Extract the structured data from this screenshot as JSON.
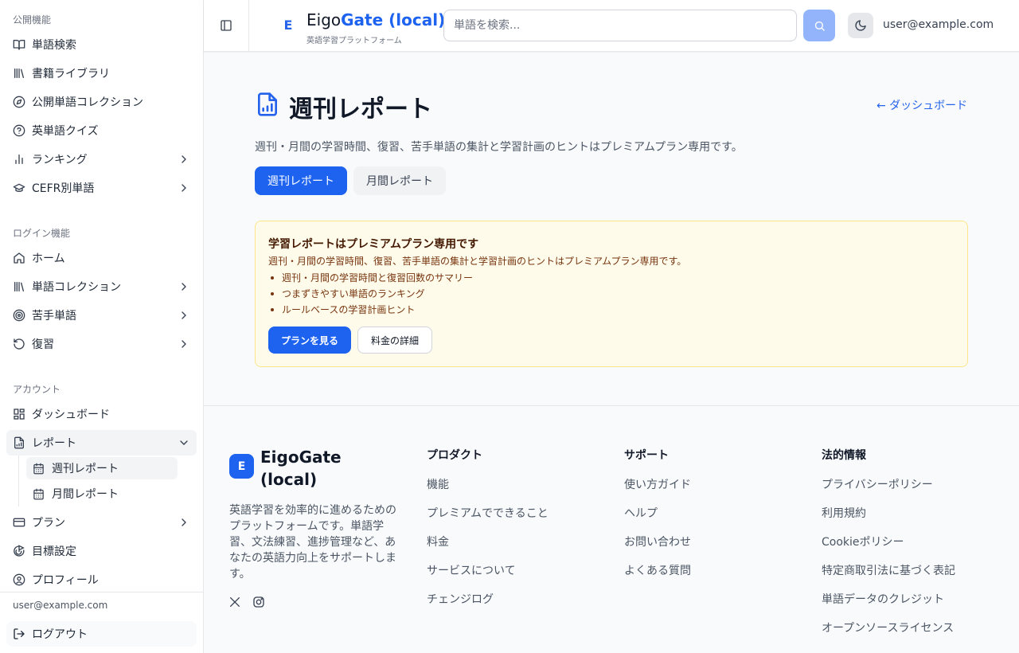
{
  "sidebar": {
    "sections": {
      "public": "公開機能",
      "login": "ログイン機能",
      "account": "アカウント"
    },
    "items": {
      "word_search": "単語検索",
      "book_library": "書籍ライブラリ",
      "public_collections": "公開単語コレクション",
      "quiz": "英単語クイズ",
      "ranking": "ランキング",
      "cefr": "CEFR別単語",
      "home": "ホーム",
      "word_collections": "単語コレクション",
      "weak_words": "苦手単語",
      "review": "復習",
      "dashboard": "ダッシュボード",
      "reports": "レポート",
      "weekly_report": "週刊レポート",
      "monthly_report": "月間レポート",
      "plan": "プラン",
      "goals": "目標設定",
      "profile": "プロフィール"
    },
    "user_email": "user@example.com",
    "logout": "ログアウト"
  },
  "header": {
    "logo_letter": "E",
    "brand_main": "Eigo",
    "brand_accent": "Gate (local)",
    "tagline": "英語学習プラットフォーム",
    "search_placeholder": "単語を検索...",
    "user_email": "user@example.com"
  },
  "main": {
    "title": "週刊レポート",
    "back_link": "← ダッシュボード",
    "description": "週刊・月間の学習時間、復習、苦手単語の集計と学習計画のヒントはプレミアムプラン専用です。",
    "tabs": {
      "weekly": "週刊レポート",
      "monthly": "月間レポート"
    },
    "promo": {
      "title": "学習レポートはプレミアムプラン専用です",
      "description": "週刊・月間の学習時間、復習、苦手単語の集計と学習計画のヒントはプレミアムプラン専用です。",
      "features": [
        "週刊・月間の学習時間と復習回数のサマリー",
        "つまずきやすい単語のランキング",
        "ルールベースの学習計画ヒント"
      ],
      "primary_button": "プランを見る",
      "secondary_button": "料金の詳細"
    }
  },
  "footer": {
    "logo_letter": "E",
    "brand": "EigoGate (local)",
    "description": "英語学習を効率的に進めるためのプラットフォームです。単語学習、文法練習、進捗管理など、あなたの英語力向上をサポートします。",
    "columns": {
      "product": {
        "title": "プロダクト",
        "links": [
          "機能",
          "プレミアムでできること",
          "料金",
          "サービスについて",
          "チェンジログ"
        ]
      },
      "support": {
        "title": "サポート",
        "links": [
          "使い方ガイド",
          "ヘルプ",
          "お問い合わせ",
          "よくある質問"
        ]
      },
      "legal": {
        "title": "法的情報",
        "links": [
          "プライバシーポリシー",
          "利用規約",
          "Cookieポリシー",
          "特定商取引法に基づく表記",
          "単語データのクレジット",
          "オープンソースライセンス"
        ]
      }
    }
  },
  "colors": {
    "primary": "#1d63f0",
    "promo_bg": "#fefbea",
    "promo_border": "#fde68a"
  },
  "icons": [
    "book-open-icon",
    "library-icon",
    "compass-icon",
    "help-circle-icon",
    "bar-chart-icon",
    "graduation-cap-icon",
    "home-icon",
    "target-icon",
    "rotate-ccw-icon",
    "layout-dashboard-icon",
    "file-chart-icon",
    "calendar-icon",
    "credit-card-icon",
    "goal-icon",
    "user-circle-icon",
    "log-out-icon",
    "panel-left-icon",
    "search-icon",
    "moon-icon",
    "x-logo-icon",
    "instagram-icon",
    "chevron-right-icon",
    "chevron-down-icon"
  ]
}
